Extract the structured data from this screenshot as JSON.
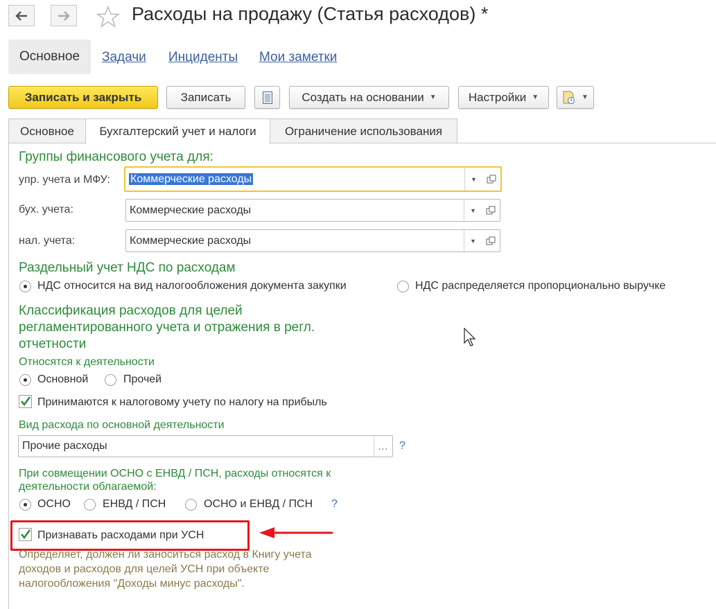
{
  "window": {
    "title": "Расходы на продажу (Статья расходов) *"
  },
  "nav": {
    "back_icon": "arrow-left-icon",
    "forward_icon": "arrow-right-icon",
    "favorite_icon": "star-icon"
  },
  "section_tabs": [
    {
      "label": "Основное",
      "active": true
    },
    {
      "label": "Задачи"
    },
    {
      "label": "Инциденты"
    },
    {
      "label": "Мои заметки"
    }
  ],
  "toolbar": {
    "save_close": "Записать и закрыть",
    "save": "Записать",
    "list_icon": "document-list-icon",
    "create_based": "Создать на основании",
    "settings": "Настройки",
    "report_icon": "report-icon"
  },
  "form_tabs": [
    {
      "label": "Основное"
    },
    {
      "label": "Бухгалтерский учет и налоги",
      "active": true
    },
    {
      "label": "Ограничение использования"
    }
  ],
  "fin_groups": {
    "heading": "Группы финансового учета для:",
    "rows": [
      {
        "label": "упр. учета и МФУ:",
        "value": "Коммерческие расходы",
        "focused": true
      },
      {
        "label": "бух. учета:",
        "value": "Коммерческие расходы"
      },
      {
        "label": "нал. учета:",
        "value": "Коммерческие расходы"
      }
    ]
  },
  "vat": {
    "heading": "Раздельный учет НДС по расходам",
    "options": [
      {
        "label": "НДС относится на вид налогообложения документа закупки",
        "selected": true
      },
      {
        "label": "НДС распределяется пропорционально выручке",
        "selected": false
      }
    ]
  },
  "classification": {
    "heading_lines": [
      "Классификация расходов для целей",
      "регламентированного учета и отражения в регл.",
      "отчетности"
    ],
    "activity_label": "Относятся к деятельности",
    "activity_options": [
      {
        "label": "Основной",
        "selected": true
      },
      {
        "label": "Прочей",
        "selected": false
      }
    ],
    "profit_tax_checkbox": {
      "label": "Принимаются к налоговому учету по налогу на прибыль",
      "checked": true
    },
    "expense_kind_label": "Вид расхода по основной деятельности",
    "expense_kind_value": "Прочие расходы",
    "expense_kind_select_btn": "...",
    "help_mark": "?",
    "combined_label_lines": [
      "При совмещении ОСНО с ЕНВД / ПСН, расходы относятся к",
      "деятельности облагаемой:"
    ],
    "combined_options": [
      {
        "label": "ОСНО",
        "selected": true
      },
      {
        "label": "ЕНВД / ПСН",
        "selected": false
      },
      {
        "label": "ОСНО и ЕНВД / ПСН",
        "selected": false
      }
    ],
    "usn_checkbox": {
      "label": "Признавать расходами при УСН",
      "checked": true
    },
    "usn_description_lines": [
      "Определяет, должен ли заноситься расход в Книгу учета",
      "доходов и расходов для целей УСН при объекте",
      "налогообложения \"Доходы минус расходы\"."
    ]
  },
  "annotation": {
    "highlight_color": "#e8161b"
  }
}
